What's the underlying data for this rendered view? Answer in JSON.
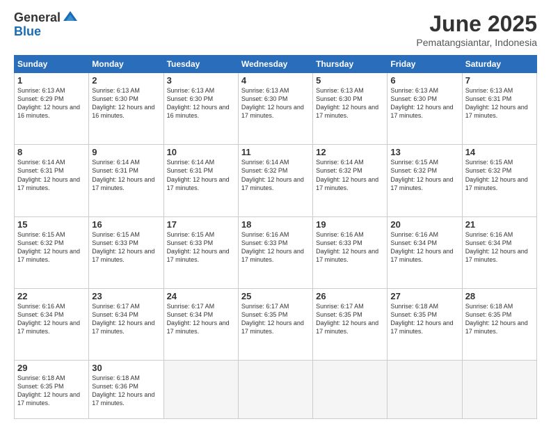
{
  "header": {
    "logo_general": "General",
    "logo_blue": "Blue",
    "month_title": "June 2025",
    "location": "Pematangsiantar, Indonesia"
  },
  "calendar": {
    "days_of_week": [
      "Sunday",
      "Monday",
      "Tuesday",
      "Wednesday",
      "Thursday",
      "Friday",
      "Saturday"
    ],
    "weeks": [
      [
        {
          "day": "",
          "empty": true
        },
        {
          "day": "",
          "empty": true
        },
        {
          "day": "",
          "empty": true
        },
        {
          "day": "",
          "empty": true
        },
        {
          "day": "",
          "empty": true
        },
        {
          "day": "",
          "empty": true
        },
        {
          "day": "",
          "empty": true
        }
      ],
      [
        {
          "day": "1",
          "sunrise": "6:13 AM",
          "sunset": "6:29 PM",
          "daylight": "12 hours and 16 minutes."
        },
        {
          "day": "2",
          "sunrise": "6:13 AM",
          "sunset": "6:30 PM",
          "daylight": "12 hours and 16 minutes."
        },
        {
          "day": "3",
          "sunrise": "6:13 AM",
          "sunset": "6:30 PM",
          "daylight": "12 hours and 16 minutes."
        },
        {
          "day": "4",
          "sunrise": "6:13 AM",
          "sunset": "6:30 PM",
          "daylight": "12 hours and 17 minutes."
        },
        {
          "day": "5",
          "sunrise": "6:13 AM",
          "sunset": "6:30 PM",
          "daylight": "12 hours and 17 minutes."
        },
        {
          "day": "6",
          "sunrise": "6:13 AM",
          "sunset": "6:30 PM",
          "daylight": "12 hours and 17 minutes."
        },
        {
          "day": "7",
          "sunrise": "6:13 AM",
          "sunset": "6:31 PM",
          "daylight": "12 hours and 17 minutes."
        }
      ],
      [
        {
          "day": "8",
          "sunrise": "6:14 AM",
          "sunset": "6:31 PM",
          "daylight": "12 hours and 17 minutes."
        },
        {
          "day": "9",
          "sunrise": "6:14 AM",
          "sunset": "6:31 PM",
          "daylight": "12 hours and 17 minutes."
        },
        {
          "day": "10",
          "sunrise": "6:14 AM",
          "sunset": "6:31 PM",
          "daylight": "12 hours and 17 minutes."
        },
        {
          "day": "11",
          "sunrise": "6:14 AM",
          "sunset": "6:32 PM",
          "daylight": "12 hours and 17 minutes."
        },
        {
          "day": "12",
          "sunrise": "6:14 AM",
          "sunset": "6:32 PM",
          "daylight": "12 hours and 17 minutes."
        },
        {
          "day": "13",
          "sunrise": "6:15 AM",
          "sunset": "6:32 PM",
          "daylight": "12 hours and 17 minutes."
        },
        {
          "day": "14",
          "sunrise": "6:15 AM",
          "sunset": "6:32 PM",
          "daylight": "12 hours and 17 minutes."
        }
      ],
      [
        {
          "day": "15",
          "sunrise": "6:15 AM",
          "sunset": "6:32 PM",
          "daylight": "12 hours and 17 minutes."
        },
        {
          "day": "16",
          "sunrise": "6:15 AM",
          "sunset": "6:33 PM",
          "daylight": "12 hours and 17 minutes."
        },
        {
          "day": "17",
          "sunrise": "6:15 AM",
          "sunset": "6:33 PM",
          "daylight": "12 hours and 17 minutes."
        },
        {
          "day": "18",
          "sunrise": "6:16 AM",
          "sunset": "6:33 PM",
          "daylight": "12 hours and 17 minutes."
        },
        {
          "day": "19",
          "sunrise": "6:16 AM",
          "sunset": "6:33 PM",
          "daylight": "12 hours and 17 minutes."
        },
        {
          "day": "20",
          "sunrise": "6:16 AM",
          "sunset": "6:34 PM",
          "daylight": "12 hours and 17 minutes."
        },
        {
          "day": "21",
          "sunrise": "6:16 AM",
          "sunset": "6:34 PM",
          "daylight": "12 hours and 17 minutes."
        }
      ],
      [
        {
          "day": "22",
          "sunrise": "6:16 AM",
          "sunset": "6:34 PM",
          "daylight": "12 hours and 17 minutes."
        },
        {
          "day": "23",
          "sunrise": "6:17 AM",
          "sunset": "6:34 PM",
          "daylight": "12 hours and 17 minutes."
        },
        {
          "day": "24",
          "sunrise": "6:17 AM",
          "sunset": "6:34 PM",
          "daylight": "12 hours and 17 minutes."
        },
        {
          "day": "25",
          "sunrise": "6:17 AM",
          "sunset": "6:35 PM",
          "daylight": "12 hours and 17 minutes."
        },
        {
          "day": "26",
          "sunrise": "6:17 AM",
          "sunset": "6:35 PM",
          "daylight": "12 hours and 17 minutes."
        },
        {
          "day": "27",
          "sunrise": "6:18 AM",
          "sunset": "6:35 PM",
          "daylight": "12 hours and 17 minutes."
        },
        {
          "day": "28",
          "sunrise": "6:18 AM",
          "sunset": "6:35 PM",
          "daylight": "12 hours and 17 minutes."
        }
      ],
      [
        {
          "day": "29",
          "sunrise": "6:18 AM",
          "sunset": "6:35 PM",
          "daylight": "12 hours and 17 minutes."
        },
        {
          "day": "30",
          "sunrise": "6:18 AM",
          "sunset": "6:36 PM",
          "daylight": "12 hours and 17 minutes."
        },
        {
          "day": "",
          "empty": true
        },
        {
          "day": "",
          "empty": true
        },
        {
          "day": "",
          "empty": true
        },
        {
          "day": "",
          "empty": true
        },
        {
          "day": "",
          "empty": true
        }
      ]
    ]
  }
}
